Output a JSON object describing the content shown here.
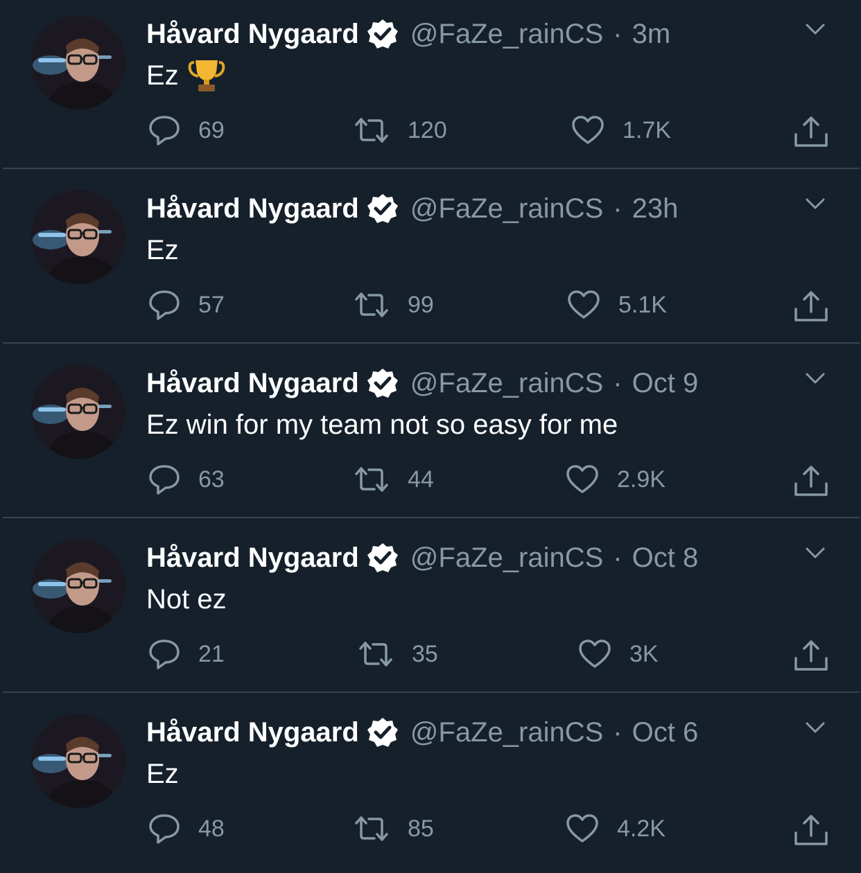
{
  "tweets": [
    {
      "name": "Håvard Nygaard",
      "handle": "@FaZe_rainCS",
      "separator": "·",
      "time": "3m",
      "text": "Ez",
      "has_trophy": true,
      "replies": "69",
      "retweets": "120",
      "likes": "1.7K"
    },
    {
      "name": "Håvard Nygaard",
      "handle": "@FaZe_rainCS",
      "separator": "·",
      "time": "23h",
      "text": "Ez",
      "has_trophy": false,
      "replies": "57",
      "retweets": "99",
      "likes": "5.1K"
    },
    {
      "name": "Håvard Nygaard",
      "handle": "@FaZe_rainCS",
      "separator": "·",
      "time": "Oct 9",
      "text": "Ez win for my team not so easy for me",
      "has_trophy": false,
      "replies": "63",
      "retweets": "44",
      "likes": "2.9K"
    },
    {
      "name": "Håvard Nygaard",
      "handle": "@FaZe_rainCS",
      "separator": "·",
      "time": "Oct 8",
      "text": "Not ez",
      "has_trophy": false,
      "replies": "21",
      "retweets": "35",
      "likes": "3K"
    },
    {
      "name": "Håvard Nygaard",
      "handle": "@FaZe_rainCS",
      "separator": "·",
      "time": "Oct 6",
      "text": "Ez",
      "has_trophy": false,
      "replies": "48",
      "retweets": "85",
      "likes": "4.2K"
    }
  ],
  "icons": {
    "verified": "verified-badge-icon",
    "caret": "chevron-down-icon",
    "reply": "reply-bubble-icon",
    "retweet": "retweet-icon",
    "like": "heart-icon",
    "share": "share-upload-icon",
    "trophy": "trophy-emoji-icon"
  },
  "colors": {
    "background": "#15202b",
    "divider": "#38444d",
    "primary_text": "#ffffff",
    "secondary_text": "#8899a6"
  }
}
